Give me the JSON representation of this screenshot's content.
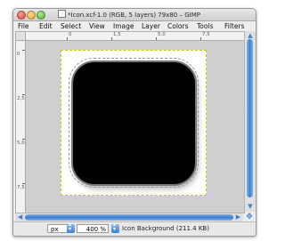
{
  "window": {
    "title": "*Icon.xcf-1.0 (RGB, 5 layers) 79x80 – GIMP"
  },
  "menubar": {
    "items": [
      "File",
      "Edit",
      "Select",
      "View",
      "Image",
      "Layer",
      "Colors",
      "Tools",
      "Filters"
    ]
  },
  "rulers": {
    "horizontal_ticks": [
      "0",
      "1,5",
      "5,0",
      "7,5"
    ],
    "vertical_ticks": [
      "0",
      "2,5",
      "5,0",
      "7,5"
    ]
  },
  "statusbar": {
    "unit": "px",
    "zoom": "400 %",
    "layer_info": "Icon Background (211.4 KB)"
  },
  "colors": {
    "accent": "#3b7fd1",
    "icon_fill": "#000000"
  }
}
